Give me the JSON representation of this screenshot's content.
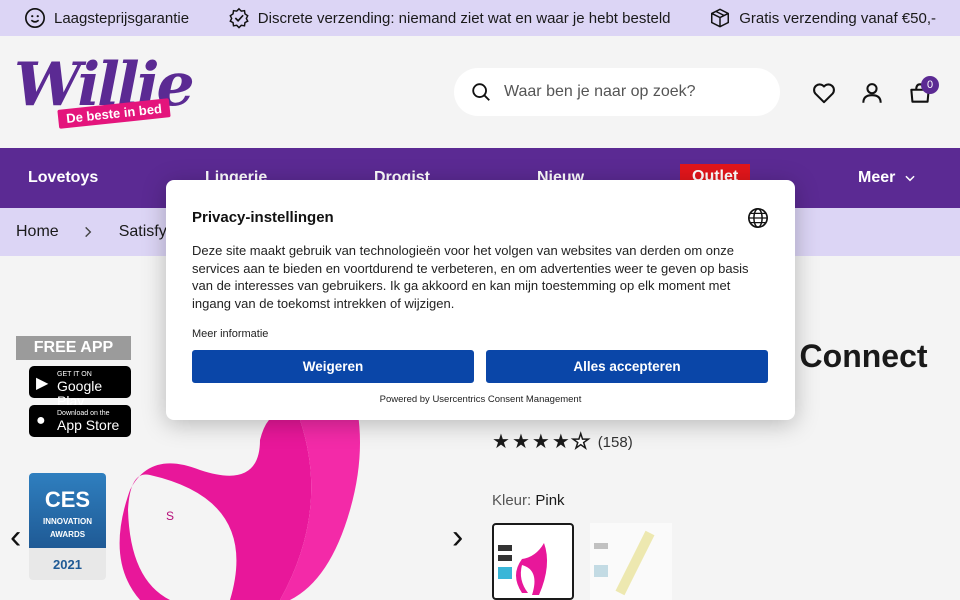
{
  "usp": [
    {
      "icon": "smiley-icon",
      "label": "Laagsteprijsgarantie"
    },
    {
      "icon": "badge-check-icon",
      "label": "Discrete verzending: niemand ziet wat en waar je hebt besteld"
    },
    {
      "icon": "package-icon",
      "label": "Gratis verzending vanaf €50,-"
    }
  ],
  "logo": {
    "word": "Willie",
    "tagline": "De beste in bed"
  },
  "search": {
    "placeholder": "Waar ben je naar op zoek?"
  },
  "cart": {
    "count": "0"
  },
  "nav": {
    "items": [
      "Lovetoys",
      "Lingerie",
      "Drogist",
      "Nieuw",
      "Outlet"
    ],
    "more": "Meer"
  },
  "breadcrumb": {
    "home": "Home",
    "current": "Satisfy"
  },
  "promo": {
    "free_app": "FREE APP",
    "google_small": "GET IT ON",
    "google_big": "Google Play",
    "apple_small": "Download on the",
    "apple_big": "App Store",
    "ces_title": "CES",
    "ces_line1": "INNOVATION",
    "ces_line2": "AWARDS",
    "ces_year": "2021"
  },
  "product": {
    "title_fragment": "t Connect",
    "rating": 4,
    "rating_max": 5,
    "review_count": "(158)",
    "color_label": "Kleur:",
    "color_value": "Pink"
  },
  "consent": {
    "title": "Privacy-instellingen",
    "body": "Deze site maakt gebruik van technologieën voor het volgen van websites van derden om onze services aan te bieden en voortdurend te verbeteren, en om advertenties weer te geven op basis van de interesses van gebruikers. Ik ga akkoord en kan mijn toestemming op elk moment met ingang van de toekomst intrekken of wijzigen.",
    "more_info": "Meer informatie",
    "deny": "Weigeren",
    "accept": "Alles accepteren",
    "powered": "Powered by Usercentrics Consent Management"
  },
  "colors": {
    "brand": "#5b2a93",
    "accent": "#e4147c",
    "outlet": "#e3161b",
    "consent_button": "#0a46a8",
    "tint": "#dcd5f5"
  }
}
